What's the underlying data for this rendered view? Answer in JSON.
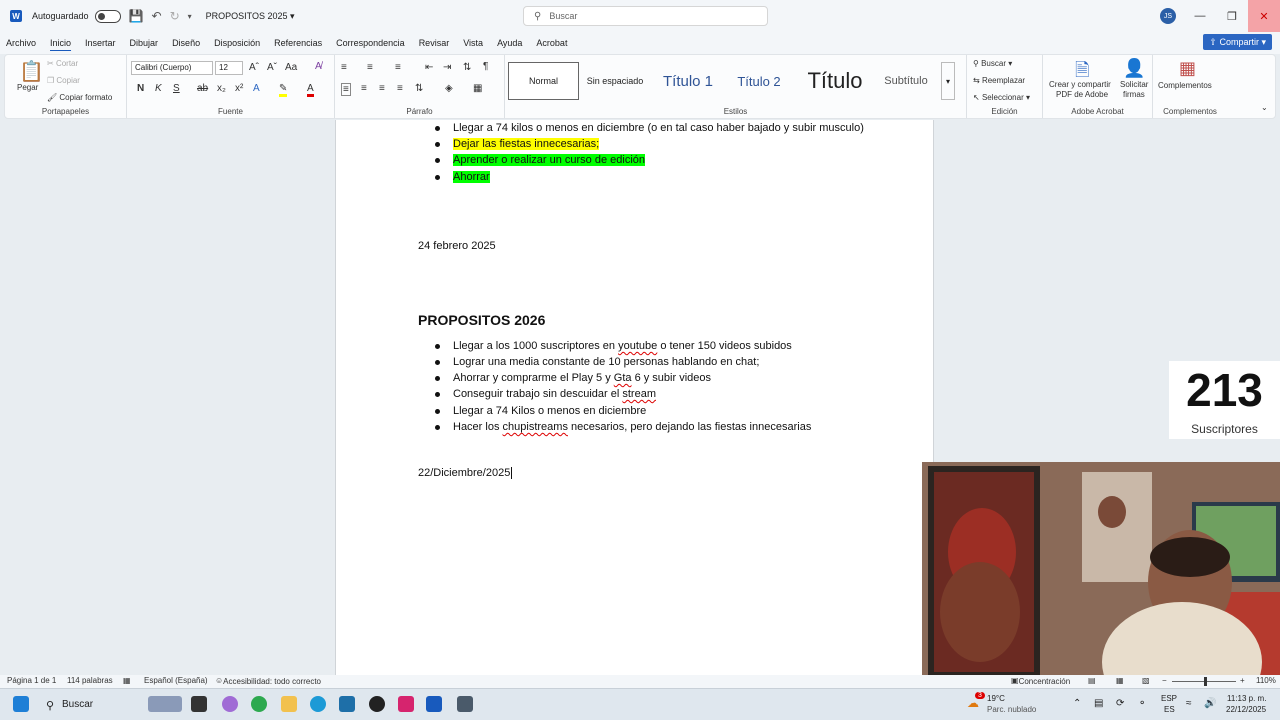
{
  "titlebar": {
    "autosave_label": "Autoguardado",
    "doc_title": "PROPOSITOS 2025",
    "search_placeholder": "Buscar",
    "avatar_initials": "JS"
  },
  "menu": {
    "tabs": [
      "Archivo",
      "Inicio",
      "Insertar",
      "Dibujar",
      "Diseño",
      "Disposición",
      "Referencias",
      "Correspondencia",
      "Revisar",
      "Vista",
      "Ayuda",
      "Acrobat"
    ],
    "active": "Inicio",
    "share_label": "Compartir"
  },
  "ribbon": {
    "clipboard": {
      "paste": "Pegar",
      "cut": "Cortar",
      "copy": "Copiar",
      "format_painter": "Copiar formato",
      "label": "Portapapeles"
    },
    "font": {
      "family": "Calibri (Cuerpo)",
      "size": "12",
      "label": "Fuente"
    },
    "paragraph": {
      "label": "Párrafo"
    },
    "styles": {
      "items": [
        "Normal",
        "Sin espaciado",
        "Título 1",
        "Título 2",
        "Título",
        "Subtítulo"
      ],
      "label": "Estilos"
    },
    "editing": {
      "find": "Buscar",
      "replace": "Reemplazar",
      "select": "Seleccionar",
      "label": "Edición"
    },
    "acrobat": {
      "create": "Crear y compartir",
      "create2": "PDF de Adobe",
      "sign": "Solicitar",
      "sign2": "firmas",
      "label": "Adobe Acrobat"
    },
    "addins": {
      "button": "Complementos",
      "label": "Complementos"
    }
  },
  "document": {
    "top_bullets": [
      "Llegar a 74 kilos o menos en diciembre (o en tal caso haber bajado y subir musculo)",
      "Dejar las fiestas innecesarias;",
      "Aprender o realizar un curso de edición",
      "Ahorrar"
    ],
    "date1": "24 febrero 2025",
    "heading": "PROPOSITOS 2026",
    "bullets_2026": {
      "b1_pre": "Llegar a los 1000 suscriptores en ",
      "b1_link": "youtube",
      "b1_post": " o tener 150 videos subidos",
      "b2": "Lograr una media constante de 10 personas hablando en chat;",
      "b3_pre": "Ahorrar y comprarme el Play 5 y ",
      "b3_link": "Gta",
      "b3_post": " 6 y subir videos",
      "b4_pre": "Conseguir trabajo sin descuidar el ",
      "b4_link": "stream",
      "b5": "Llegar a 74 Kilos o menos en diciembre",
      "b6_pre": "Hacer los ",
      "b6_link": "chupistreams",
      "b6_post": " necesarios, pero dejando las fiestas innecesarias"
    },
    "date2": "22/Diciembre/2025"
  },
  "overlay": {
    "subscriber_count": "213",
    "subscriber_label": "Suscriptores"
  },
  "statusbar": {
    "page": "Página 1 de 1",
    "words": "114 palabras",
    "language": "Español (España)",
    "accessibility": "Accesibilidad: todo correcto",
    "focus": "Concentración",
    "zoom": "110%"
  },
  "taskbar": {
    "search_placeholder": "Buscar",
    "weather_temp": "19°C",
    "weather_desc": "Parc. nublado",
    "weather_badge": "3",
    "lang1": "ESP",
    "lang2": "ES",
    "time": "11:13 p. m.",
    "date": "22/12/2025"
  }
}
